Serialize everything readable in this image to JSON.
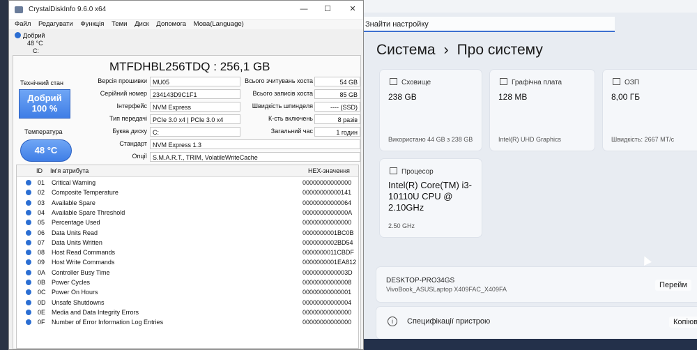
{
  "cdi": {
    "title": "CrystalDiskInfo 9.6.0 x64",
    "menu": [
      "Файл",
      "Редагувати",
      "Функція",
      "Теми",
      "Диск",
      "Допомога",
      "Мова(Language)"
    ],
    "drive_status": {
      "health": "Добрий",
      "temp": "48 °C",
      "letter": "C:"
    },
    "drive_name": "MTFDHBL256TDQ : 256,1 GB",
    "health_label": "Технічний стан",
    "health_value": "Добрий",
    "health_percent": "100 %",
    "temp_label": "Температура",
    "temp_value": "48 °C",
    "left_fields": [
      {
        "key": "Версія прошивки",
        "value": "MU05"
      },
      {
        "key": "Серійний номер",
        "value": "234143D9C1F1"
      },
      {
        "key": "Інтерфейс",
        "value": "NVM Express"
      },
      {
        "key": "Тип передачі",
        "value": "PCIe 3.0 x4 | PCIe 3.0 x4"
      },
      {
        "key": "Буква диску",
        "value": "C:"
      }
    ],
    "right_fields": [
      {
        "key": "Всього зчитувань хоста",
        "value": "54 GB"
      },
      {
        "key": "Всього записів хоста",
        "value": "85 GB"
      },
      {
        "key": "Швидкість шпинделя",
        "value": "---- (SSD)"
      },
      {
        "key": "К-сть включень",
        "value": "8 разів"
      },
      {
        "key": "Загальний час",
        "value": "1 годин"
      }
    ],
    "standard": {
      "key": "Стандарт",
      "value": "NVM Express 1.3"
    },
    "features": {
      "key": "Опції",
      "value": "S.M.A.R.T., TRIM, VolatileWriteCache"
    },
    "table_headers": {
      "id": "ID",
      "name": "Ім'я атрибута",
      "raw": "HEX-значення"
    },
    "attributes": [
      {
        "id": "01",
        "name": "Critical Warning",
        "raw": "00000000000000"
      },
      {
        "id": "02",
        "name": "Composite Temperature",
        "raw": "00000000000141"
      },
      {
        "id": "03",
        "name": "Available Spare",
        "raw": "00000000000064"
      },
      {
        "id": "04",
        "name": "Available Spare Threshold",
        "raw": "0000000000000A"
      },
      {
        "id": "05",
        "name": "Percentage Used",
        "raw": "00000000000000"
      },
      {
        "id": "06",
        "name": "Data Units Read",
        "raw": "0000000001BC0B"
      },
      {
        "id": "07",
        "name": "Data Units Written",
        "raw": "0000000002BD54"
      },
      {
        "id": "08",
        "name": "Host Read Commands",
        "raw": "0000000011CBDF"
      },
      {
        "id": "09",
        "name": "Host Write Commands",
        "raw": "0000000001EA812"
      },
      {
        "id": "0A",
        "name": "Controller Busy Time",
        "raw": "0000000000003D"
      },
      {
        "id": "0B",
        "name": "Power Cycles",
        "raw": "00000000000008"
      },
      {
        "id": "0C",
        "name": "Power On Hours",
        "raw": "00000000000001"
      },
      {
        "id": "0D",
        "name": "Unsafe Shutdowns",
        "raw": "00000000000004"
      },
      {
        "id": "0E",
        "name": "Media and Data Integrity Errors",
        "raw": "00000000000000"
      },
      {
        "id": "0F",
        "name": "Number of Error Information Log Entries",
        "raw": "00000000000000"
      }
    ],
    "colors": {
      "health_blue": "#3f7ee6",
      "status_dot": "#2b6ed2"
    }
  },
  "settings": {
    "search_placeholder": "Знайти настройку",
    "breadcrumb_parent": "Система",
    "breadcrumb_sep": "›",
    "breadcrumb_current": "Про систему",
    "tiles": [
      {
        "label": "Сховище",
        "value": "238 GB",
        "footer": "Використано 44 GB з 238 GB"
      },
      {
        "label": "Графічна плата",
        "value": "128 MB",
        "footer": "Intel(R) UHD Graphics"
      },
      {
        "label": "ОЗП",
        "value": "8,00 ГБ",
        "footer": "Швидкість: 2667 МТ/с"
      },
      {
        "label": "Процесор",
        "value": "Intel(R) Core(TM) i3-10110U CPU @ 2.10GHz",
        "footer": "2.50 GHz"
      }
    ],
    "device_name": "DESKTOP-PRO34GS",
    "device_model": "VivoBook_ASUSLaptop X409FAC_X409FA",
    "rename_button": "Перейм",
    "specs_label": "Специфікації пристрою",
    "copy_button": "Копіюв"
  }
}
